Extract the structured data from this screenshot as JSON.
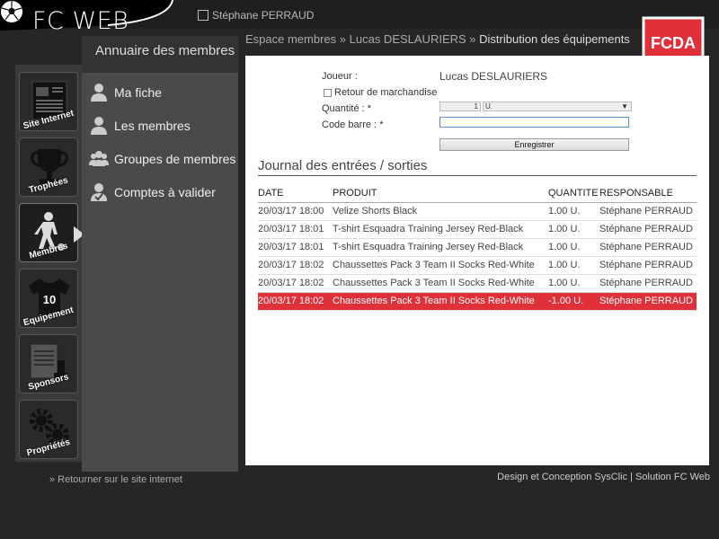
{
  "app": {
    "title": "FC WEB",
    "user": "Stéphane PERRAUD"
  },
  "colors": {
    "accent": "#e0303a",
    "sidebar": "#4a4a4a",
    "background": "#262626"
  },
  "left_nav": [
    {
      "label": "Site Internet",
      "icon": "newspaper-icon"
    },
    {
      "label": "Trophées",
      "icon": "trophy-icon"
    },
    {
      "label": "Membres",
      "icon": "player-icon",
      "active": true
    },
    {
      "label": "Equipement",
      "icon": "jersey-icon"
    },
    {
      "label": "Sponsors",
      "icon": "contract-icon"
    },
    {
      "label": "Propriétés",
      "icon": "gears-icon"
    }
  ],
  "submenu": {
    "title": "Annuaire des membres",
    "items": [
      {
        "label": "Ma fiche",
        "icon": "user-icon"
      },
      {
        "label": "Les membres",
        "icon": "user-icon"
      },
      {
        "label": "Groupes de membres",
        "icon": "group-icon"
      },
      {
        "label": "Comptes à valider",
        "icon": "user-check-icon"
      }
    ]
  },
  "breadcrumb": {
    "part1": "Espace membres",
    "sep": " » ",
    "part2": "Lucas DESLAURIERS",
    "part3": "Distribution des équipements"
  },
  "club_logo_text": "FCDA",
  "form": {
    "player_label": "Joueur :",
    "player_value": "Lucas DESLAURIERS",
    "return_label": "Retour de marchandise",
    "quantity_label": "Quantité : *",
    "quantity_value": "1",
    "unit_value": "U.",
    "barcode_label": "Code barre : *",
    "barcode_value": "",
    "save_label": "Enregistrer"
  },
  "journal": {
    "title": "Journal des entrées / sorties",
    "headers": [
      "DATE",
      "PRODUIT",
      "QUANTITE",
      "RESPONSABLE"
    ],
    "rows": [
      [
        "20/03/17 18:00",
        "Velize Shorts Black",
        "1.00 U.",
        "Stéphane PERRAUD"
      ],
      [
        "20/03/17 18:01",
        "T-shirt Esquadra Training Jersey Red-Black",
        "1.00 U.",
        "Stéphane PERRAUD"
      ],
      [
        "20/03/17 18:01",
        "T-shirt Esquadra Training Jersey Red-Black",
        "1.00 U.",
        "Stéphane PERRAUD"
      ],
      [
        "20/03/17 18:02",
        "Chaussettes Pack 3 Team II Socks Red-White",
        "1.00 U.",
        "Stéphane PERRAUD"
      ],
      [
        "20/03/17 18:02",
        "Chaussettes Pack 3 Team II Socks Red-White",
        "1.00 U.",
        "Stéphane PERRAUD"
      ],
      [
        "20/03/17 18:02",
        "Chaussettes Pack 3 Team II Socks Red-White",
        "-1.00 U.",
        "Stéphane PERRAUD"
      ]
    ]
  },
  "footer": {
    "back_link": "» Retourner sur le site internet",
    "credits": "Design et Conception SysClic | Solution FC Web"
  }
}
